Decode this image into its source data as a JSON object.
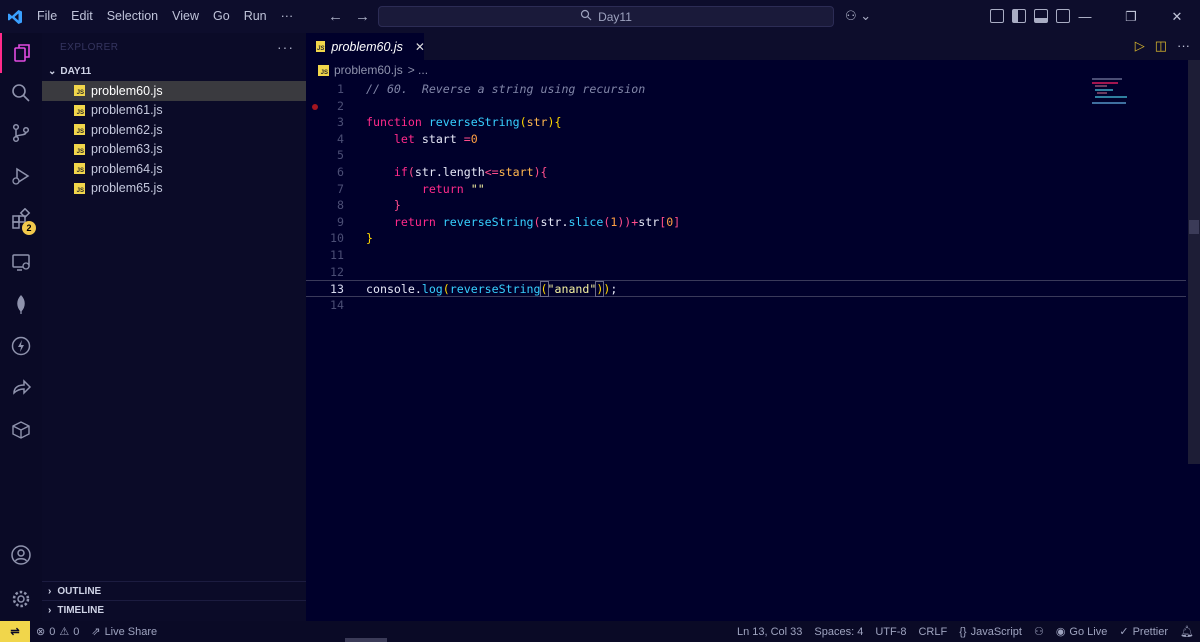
{
  "titlebar": {
    "menu": [
      "File",
      "Edit",
      "Selection",
      "View",
      "Go",
      "Run",
      "···"
    ],
    "search_text": "Day11",
    "window_controls": [
      "—",
      "❐",
      "✕"
    ]
  },
  "activity": {
    "extensions_badge": "2"
  },
  "sidebar": {
    "header": "EXPLORER",
    "more": "···",
    "folder": "DAY11",
    "files": [
      "problem60.js",
      "problem61.js",
      "problem62.js",
      "problem63.js",
      "problem64.js",
      "problem65.js"
    ],
    "outline_label": "OUTLINE",
    "timeline_label": "TIMELINE"
  },
  "editor": {
    "tab_label": "problem60.js",
    "tab_close": "✕",
    "breadcrumb_file": "problem60.js",
    "breadcrumb_sep": "> ...",
    "line_numbers": [
      "1",
      "2",
      "3",
      "4",
      "5",
      "6",
      "7",
      "8",
      "9",
      "10",
      "11",
      "12",
      "13",
      "14"
    ],
    "current_line": "13"
  },
  "statusbar": {
    "problems_errors": "0",
    "problems_warnings": "0",
    "live_share": "Live Share",
    "cursor": "Ln 13, Col 33",
    "spaces": "Spaces: 4",
    "encoding": "UTF-8",
    "eol": "CRLF",
    "language": "JavaScript",
    "go_live": "Go Live",
    "prettier": "Prettier"
  },
  "colors": {
    "editor_bg": "#00002b",
    "keyword": "#ff2a8a",
    "function": "#37d0ff",
    "accent_yellow": "#f1d64b"
  }
}
